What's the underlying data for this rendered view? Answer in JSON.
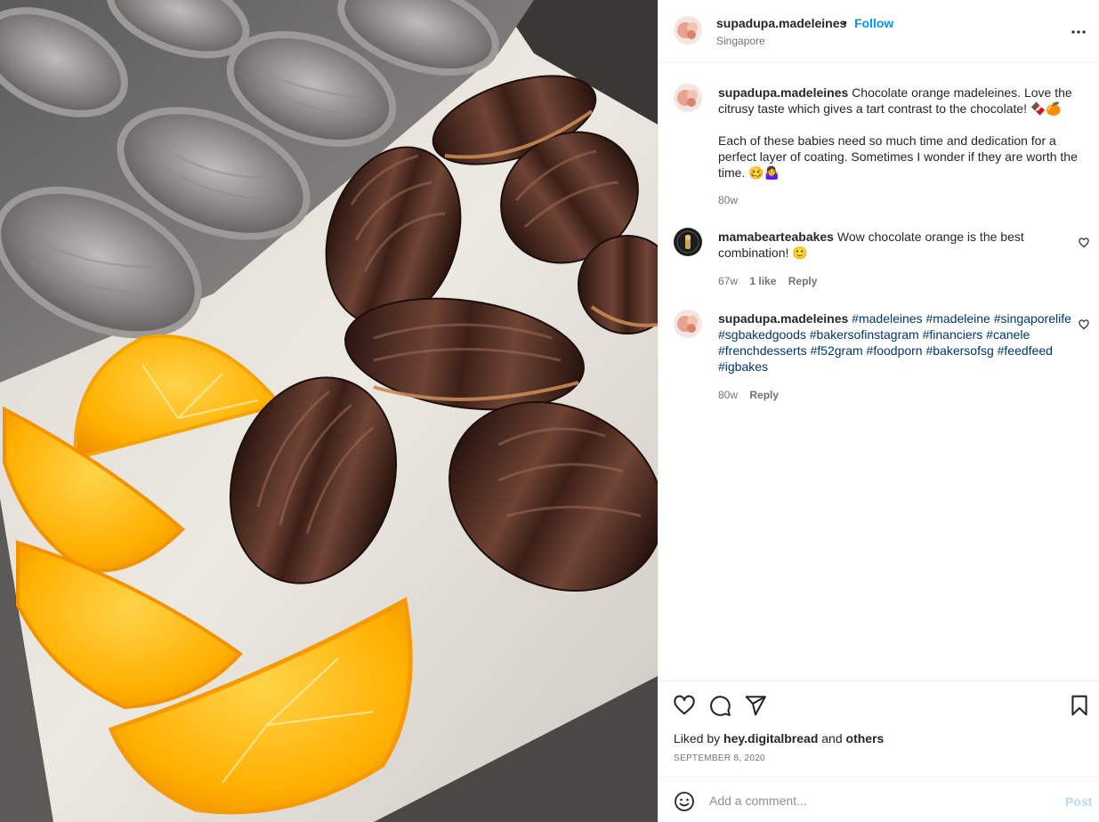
{
  "post": {
    "image_subject": "chocolate-madeleines-photo",
    "author": {
      "username": "supadupa.madeleines",
      "location": "Singapore",
      "follow_label": "Follow",
      "separator": "•"
    },
    "caption": {
      "username": "supadupa.madeleines",
      "text": "Chocolate orange madeleines. Love the citrusy taste which gives a tart contrast to the chocolate! 🍫🍊\n\nEach of these babies need so much time and dedication for a perfect layer of coating. Sometimes I wonder if they are worth the time. 🥴🤷‍♀️",
      "time": "80w"
    },
    "comments": [
      {
        "username": "mamabearteabakes",
        "text": "Wow chocolate orange is the best combination! 🙂",
        "time": "67w",
        "likes": "1 like",
        "reply_label": "Reply"
      },
      {
        "username": "supadupa.madeleines",
        "text": "#madeleines #madeleine #singaporelife #sgbakedgoods #bakersofinstagram #financiers #canele #frenchdesserts #f52gram #foodporn #bakersofsg #feedfeed #igbakes",
        "time": "80w",
        "reply_label": "Reply"
      }
    ],
    "liked_by": {
      "prefix": "Liked by",
      "user": "hey.digitalbread",
      "joiner": "and",
      "others": "others"
    },
    "date": "SEPTEMBER 8, 2020",
    "comment_input": {
      "placeholder": "Add a comment...",
      "post_label": "Post"
    },
    "icons": {
      "like": "heart-icon",
      "comment": "comment-icon",
      "share": "paper-plane-icon",
      "save": "bookmark-icon",
      "more": "more-options-icon",
      "emoji": "emoji-icon"
    },
    "colors": {
      "accent": "#0095f6",
      "hashtag": "#00376b",
      "muted": "#737373",
      "post_disabled": "#b3dbff"
    }
  }
}
